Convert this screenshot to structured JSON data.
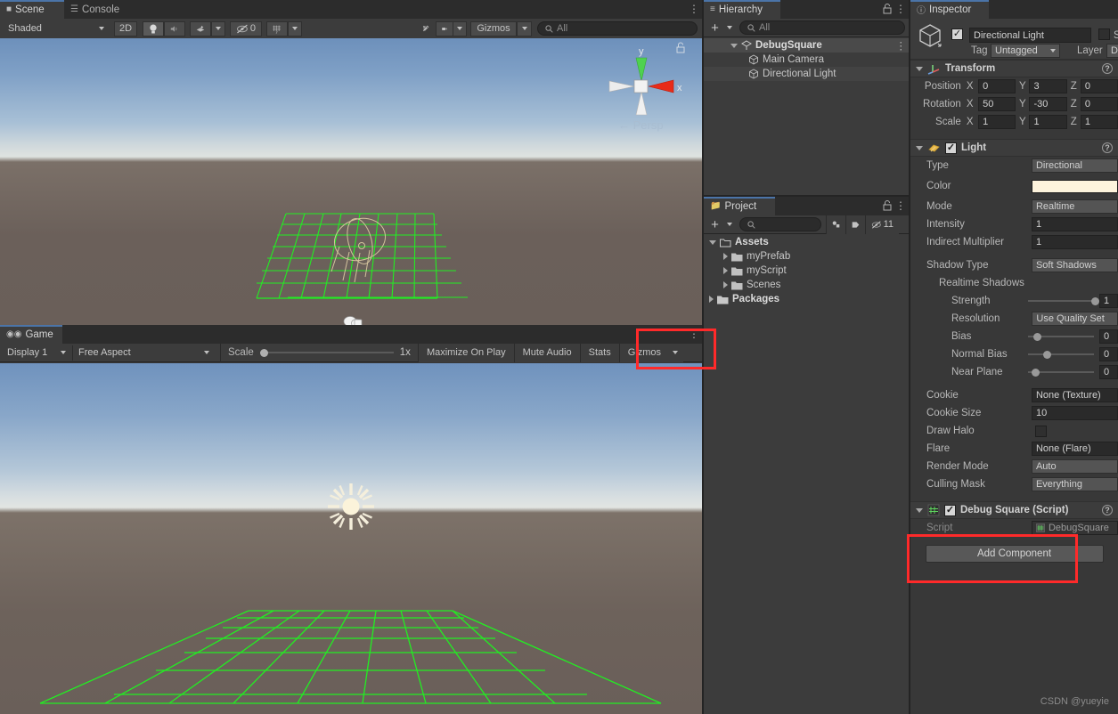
{
  "app": "Unity Editor",
  "scene_panel": {
    "tabs": [
      {
        "label": "Scene",
        "icon": "grid-icon",
        "active": true
      },
      {
        "label": "Console",
        "icon": "console-icon",
        "active": false
      }
    ],
    "toolbar": {
      "shading_mode": "Shaded",
      "mode_2d": "2D",
      "lighting_icon": "lightbulb-icon",
      "audio_icon": "speaker-icon",
      "fx_icon": "effects-icon",
      "hidden_count": "0",
      "hidden_icon": "eye-off-icon",
      "grid_icon": "grid-visibility-icon",
      "tools_icon": "tools-icon",
      "camera_icon": "camera-icon",
      "gizmos_label": "Gizmos",
      "search_placeholder": "All",
      "search_icon": "search-icon"
    },
    "gizmo": {
      "axis_y": "y",
      "axis_x": "x",
      "projection": "Persp",
      "lock_icon": "lock-icon"
    }
  },
  "game_panel": {
    "tabs": [
      {
        "label": "Game",
        "icon": "gamepad-icon",
        "active": true
      }
    ],
    "toolbar": {
      "display": "Display 1",
      "aspect": "Free Aspect",
      "scale_label": "Scale",
      "scale_value": "1x",
      "maximize_on_play": "Maximize On Play",
      "mute_audio": "Mute Audio",
      "stats": "Stats",
      "gizmos_label": "Gizmos"
    }
  },
  "hierarchy": {
    "tab": "Hierarchy",
    "tab_icon": "hierarchy-icon",
    "lock_icon": "lock-icon",
    "menu_icon": "kebab-menu-icon",
    "add_label": "+",
    "search_placeholder": "All",
    "items": [
      {
        "label": "DebugSquare",
        "icon": "scene-icon",
        "depth": 0,
        "expanded": true,
        "selected": true
      },
      {
        "label": "Main Camera",
        "icon": "gameobject-icon",
        "depth": 1,
        "selected": false
      },
      {
        "label": "Directional Light",
        "icon": "gameobject-icon",
        "depth": 1,
        "selected": true
      }
    ]
  },
  "project": {
    "tab": "Project",
    "tab_icon": "folder-icon",
    "lock_icon": "lock-icon",
    "menu_icon": "kebab-menu-icon",
    "add_label": "+",
    "search_placeholder": "",
    "filter_type_icon": "filter-type-icon",
    "filter_label_icon": "filter-label-icon",
    "hidden_icon": "eye-off-icon",
    "hidden_count": "11",
    "items": [
      {
        "label": "Assets",
        "depth": 0,
        "expanded": true,
        "bold": true
      },
      {
        "label": "myPrefab",
        "depth": 1,
        "expanded": false,
        "bold": false
      },
      {
        "label": "myScript",
        "depth": 1,
        "expanded": false,
        "bold": false
      },
      {
        "label": "Scenes",
        "depth": 1,
        "expanded": false,
        "bold": false
      },
      {
        "label": "Packages",
        "depth": 0,
        "expanded": false,
        "bold": true
      }
    ]
  },
  "inspector": {
    "tab": "Inspector",
    "tab_icon": "info-icon",
    "object_icon": "gameobject-icon",
    "enabled": true,
    "name": "Directional Light",
    "static_label": "S",
    "static_checked": false,
    "tag_label": "Tag",
    "tag_value": "Untagged",
    "layer_label": "Layer",
    "layer_value": "Defau",
    "transform": {
      "title": "Transform",
      "icon": "transform-axis-icon",
      "help_icon": "help-icon",
      "rows": [
        {
          "label": "Position",
          "x": "0",
          "y": "3",
          "z": "0"
        },
        {
          "label": "Rotation",
          "x": "50",
          "y": "-30",
          "z": "0"
        },
        {
          "label": "Scale",
          "x": "1",
          "y": "1",
          "z": "1"
        }
      ],
      "axis_labels": [
        "X",
        "Y",
        "Z"
      ]
    },
    "light": {
      "title": "Light",
      "icon": "light-icon",
      "enabled": true,
      "help_icon": "help-icon",
      "type_label": "Type",
      "type_value": "Directional",
      "color_label": "Color",
      "color_value": "#fdf3dc",
      "mode_label": "Mode",
      "mode_value": "Realtime",
      "intensity_label": "Intensity",
      "intensity_value": "1",
      "indirect_label": "Indirect Multiplier",
      "indirect_value": "1",
      "shadow_type_label": "Shadow Type",
      "shadow_type_value": "Soft Shadows",
      "realtime_shadows_label": "Realtime Shadows",
      "strength_label": "Strength",
      "strength_value": "1",
      "strength_pct": 92,
      "resolution_label": "Resolution",
      "resolution_value": "Use Quality Set",
      "bias_label": "Bias",
      "bias_value": "0",
      "bias_pct": 8,
      "normal_bias_label": "Normal Bias",
      "normal_bias_value": "0",
      "normal_bias_pct": 22,
      "near_plane_label": "Near Plane",
      "near_plane_value": "0",
      "near_plane_pct": 6,
      "cookie_label": "Cookie",
      "cookie_value": "None (Texture)",
      "cookie_size_label": "Cookie Size",
      "cookie_size_value": "10",
      "draw_halo_label": "Draw Halo",
      "draw_halo_checked": false,
      "flare_label": "Flare",
      "flare_value": "None (Flare)",
      "render_mode_label": "Render Mode",
      "render_mode_value": "Auto",
      "culling_mask_label": "Culling Mask",
      "culling_mask_value": "Everything"
    },
    "script_component": {
      "title": "Debug Square (Script)",
      "icon": "script-icon",
      "enabled": true,
      "help_icon": "help-icon",
      "script_label": "Script",
      "script_value": "DebugSquare",
      "script_value_icon": "cs-script-icon"
    },
    "add_component_label": "Add Component"
  },
  "watermark": "CSDN @yueyie",
  "highlights": {
    "accent_color": "#ff2a2a",
    "regions": [
      "game-gizmos-button",
      "debug-square-script-component"
    ]
  }
}
